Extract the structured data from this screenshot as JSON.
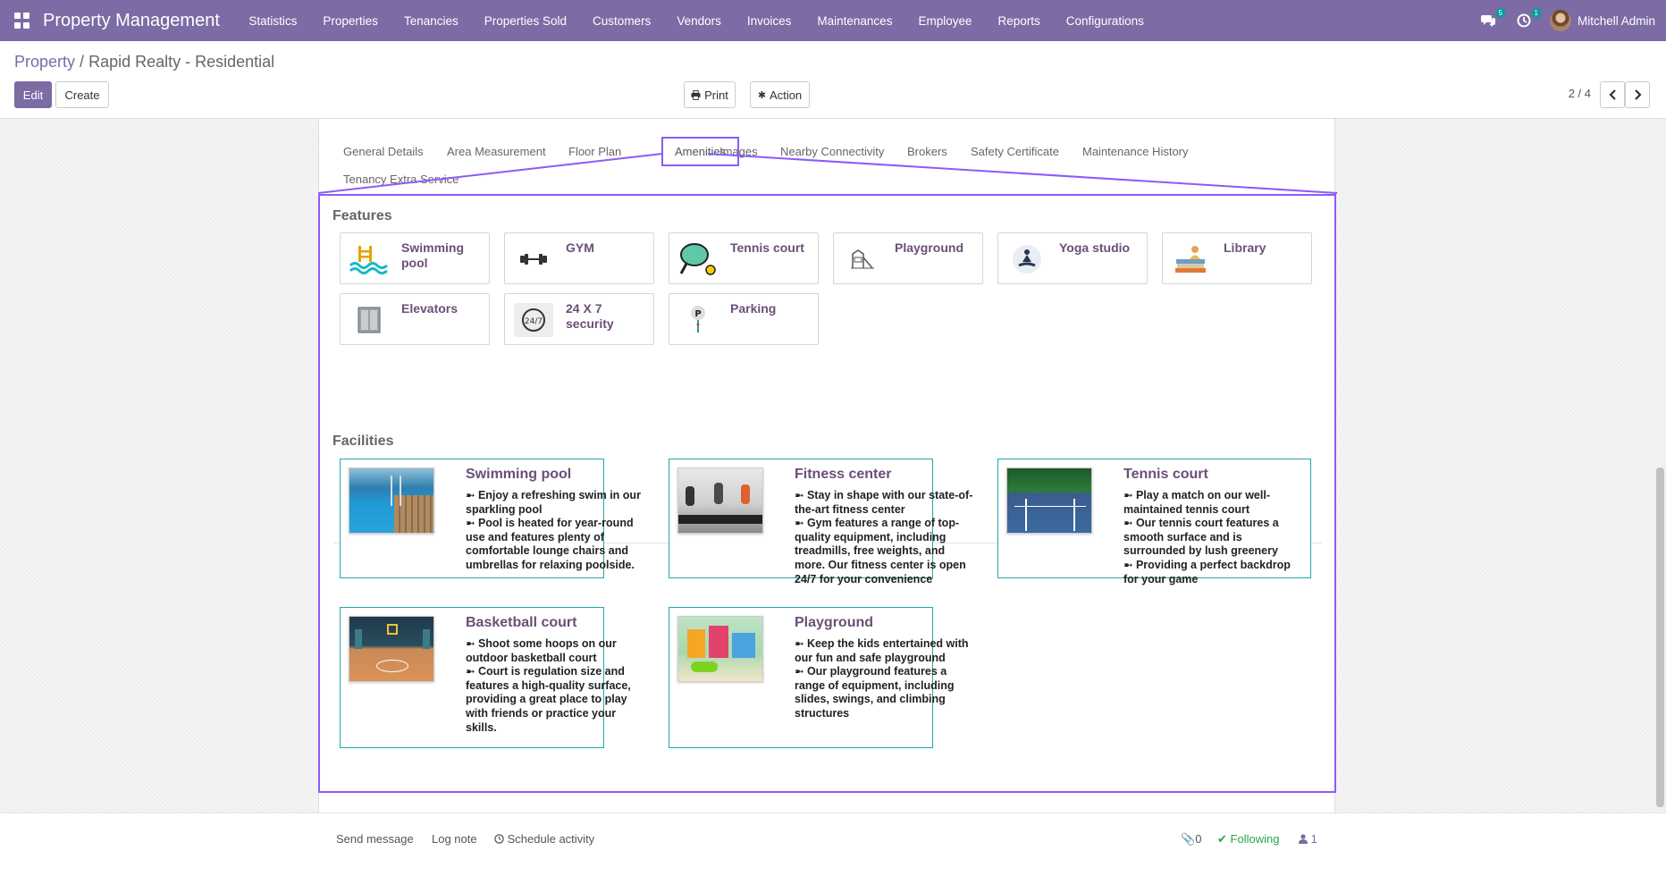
{
  "navbar": {
    "brand": "Property Management",
    "menu": [
      "Statistics",
      "Properties",
      "Tenancies",
      "Properties Sold",
      "Customers",
      "Vendors",
      "Invoices",
      "Maintenances",
      "Employee",
      "Reports",
      "Configurations"
    ],
    "messages_count": "5",
    "activities_count": "1",
    "user_name": "Mitchell Admin",
    "bg_color": "#7c6ba4"
  },
  "breadcrumb": {
    "parent": "Property",
    "separator": "/",
    "current": "Rapid Realty - Residential"
  },
  "buttons": {
    "edit": "Edit",
    "create": "Create",
    "print": "Print",
    "action": "Action"
  },
  "pager": {
    "value": "2 / 4"
  },
  "tabs": [
    "General Details",
    "Area Measurement",
    "Floor Plan",
    "Amenities",
    "Images",
    "Nearby Connectivity",
    "Brokers",
    "Safety Certificate",
    "Maintenance History",
    "Tenancy Extra Service"
  ],
  "active_tab": "Amenities",
  "features": {
    "title": "Features",
    "items": [
      {
        "label": "Swimming pool",
        "icon": "swimming-pool-icon"
      },
      {
        "label": "GYM",
        "icon": "dumbbell-icon"
      },
      {
        "label": "Tennis court",
        "icon": "racket-icon"
      },
      {
        "label": "Playground",
        "icon": "playground-icon"
      },
      {
        "label": "Yoga studio",
        "icon": "yoga-icon"
      },
      {
        "label": "Library",
        "icon": "books-icon"
      },
      {
        "label": "Elevators",
        "icon": "elevator-icon"
      },
      {
        "label": "24 X 7 security",
        "icon": "security-24-7-icon"
      },
      {
        "label": "Parking",
        "icon": "parking-icon"
      }
    ]
  },
  "facilities": {
    "title": "Facilities",
    "items": [
      {
        "title": "Swimming pool",
        "lines": [
          "➼ Enjoy a refreshing swim in our sparkling pool",
          "➼ Pool is heated for year-round use and features plenty of comfortable lounge chairs and umbrellas for relaxing poolside."
        ]
      },
      {
        "title": "Fitness center",
        "lines": [
          "➼ Stay in shape with our state-of-the-art fitness center",
          "➼ Gym features a range of top-quality equipment, including treadmills, free weights, and more. Our fitness center is open 24/7 for your convenience"
        ]
      },
      {
        "title": "Tennis court",
        "lines": [
          "➼ Play a match on our well-maintained tennis court",
          "➼ Our tennis court features a smooth surface and is surrounded by lush greenery",
          "➼ Providing a perfect backdrop for your game"
        ]
      },
      {
        "title": "Basketball court",
        "lines": [
          "➼ Shoot some hoops on our outdoor basketball court",
          "➼ Court is regulation size and features a high-quality surface, providing a great place to play with friends or practice your skills."
        ]
      },
      {
        "title": "Playground",
        "lines": [
          "➼ Keep the kids entertained with our fun and safe playground",
          "➼ Our playground features a range of equipment, including slides, swings, and climbing structures"
        ]
      }
    ]
  },
  "chatter": {
    "send_message": "Send message",
    "log_note": "Log note",
    "schedule_activity": "Schedule activity",
    "attachments": "0",
    "following": "Following",
    "followers": "1"
  },
  "colors": {
    "accent": "#8b5cf6",
    "facility_border": "#21a7a5",
    "following": "#28a745"
  }
}
